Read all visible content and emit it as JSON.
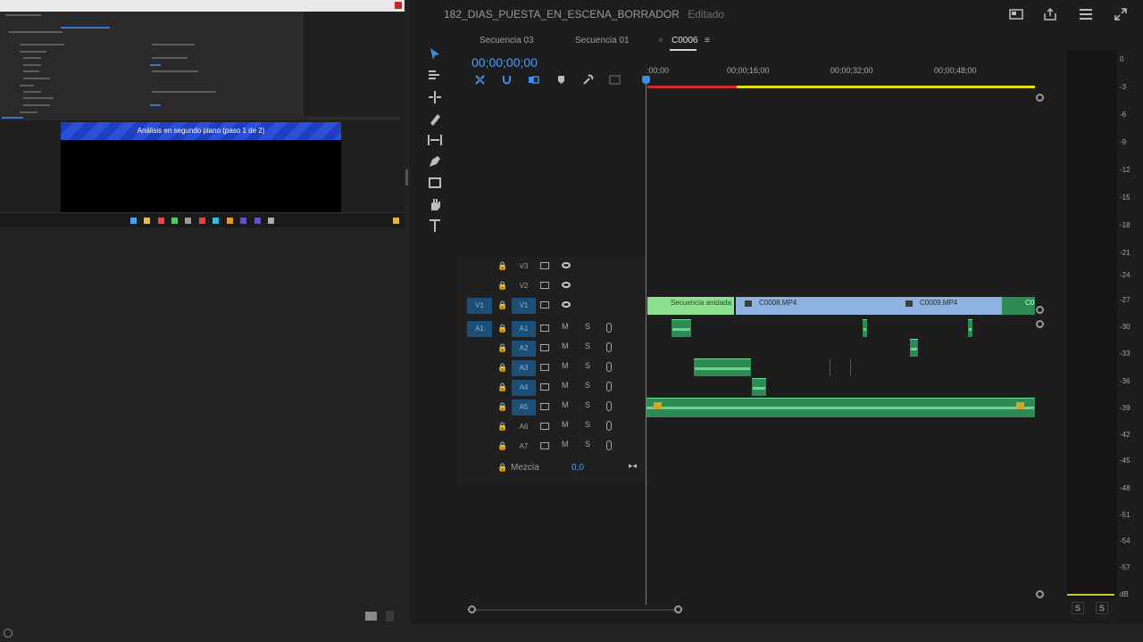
{
  "header": {
    "project_title": "182_DIAS_PUESTA_EN_ESCENA_BORRADOR",
    "status": "Editado",
    "icons": [
      "workspace-icon",
      "export-icon",
      "menu-icon",
      "fullscreen-icon"
    ]
  },
  "left_panel": {
    "screenshot_banner": "Análisis en segundo plano (paso 1 de 2)"
  },
  "timeline": {
    "tabs": [
      {
        "label": "Secuencia 03"
      },
      {
        "label": "Secuencia 01"
      },
      {
        "label": "C0006",
        "active": true
      }
    ],
    "timecode": "00;00;00;00",
    "ruler": [
      ":00;00",
      "00;00;16;00",
      "00;00;32;00",
      "00;00;48;00"
    ],
    "video_tracks": [
      {
        "name": "V3"
      },
      {
        "name": "V2"
      },
      {
        "name": "V1",
        "source": "V1"
      }
    ],
    "audio_tracks": [
      {
        "name": "A1",
        "source": "A1"
      },
      {
        "name": "A2"
      },
      {
        "name": "A3"
      },
      {
        "name": "A4"
      },
      {
        "name": "A5"
      },
      {
        "name": "A6"
      },
      {
        "name": "A7"
      }
    ],
    "track_buttons": {
      "mute": "M",
      "solo": "S"
    },
    "clips": {
      "nested": "Secuencia anidada",
      "c8": "C0008.MP4",
      "c9": "C0009.MP4",
      "c10": "C0"
    },
    "mix_label": "Mezcla",
    "mix_value": "0,0"
  },
  "meters": {
    "scale": [
      "0",
      "-3",
      "-6",
      "-9",
      "-12",
      "-15",
      "-18",
      "-21",
      "-24",
      "-27",
      "-30",
      "-33",
      "-36",
      "-39",
      "-42",
      "-45",
      "-48",
      "-51",
      "-54",
      "-57",
      "dB"
    ],
    "solo_left": "S",
    "solo_right": "S"
  }
}
